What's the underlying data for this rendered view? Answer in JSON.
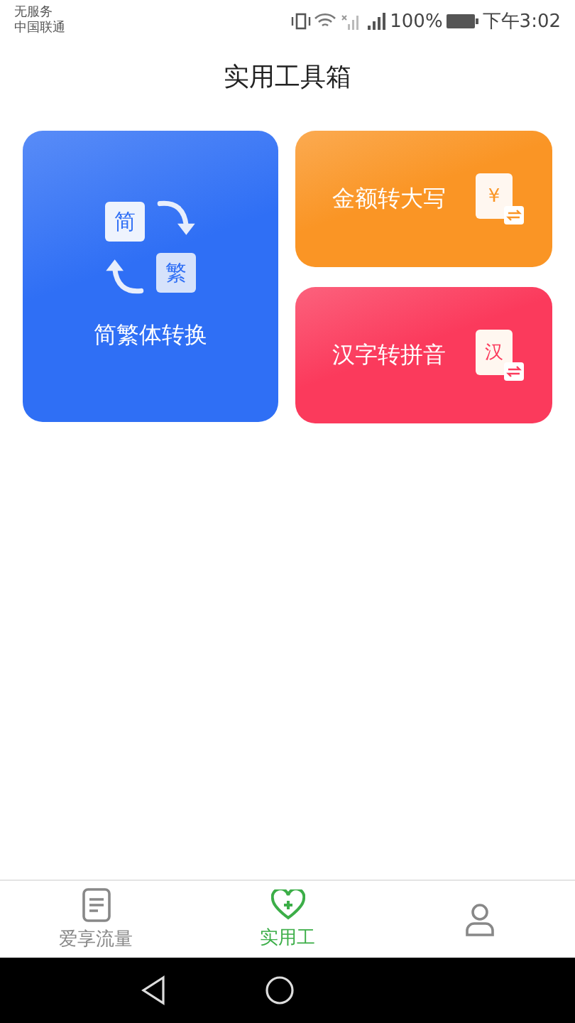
{
  "status_bar": {
    "carrier_lines": [
      "无服务",
      "中国联通"
    ],
    "battery": "100%",
    "time": "下午3:02"
  },
  "title": "实用工具箱",
  "tools": [
    {
      "kind": "large",
      "label": "简繁体转换",
      "icon_texts": [
        "简",
        "繁"
      ],
      "color": "#2f6ff5"
    },
    {
      "kind": "small",
      "label": "金额转大写",
      "icon_texts": [
        "¥"
      ],
      "color": "#fa9525"
    },
    {
      "kind": "small",
      "label": "汉字转拼音",
      "icon_texts": [
        "汉"
      ],
      "color": "#fb3a5c"
    }
  ],
  "tabs": [
    {
      "label": "爱享流量",
      "selected": false
    },
    {
      "label": "实用工",
      "selected": true
    },
    {
      "selected": false
    }
  ]
}
